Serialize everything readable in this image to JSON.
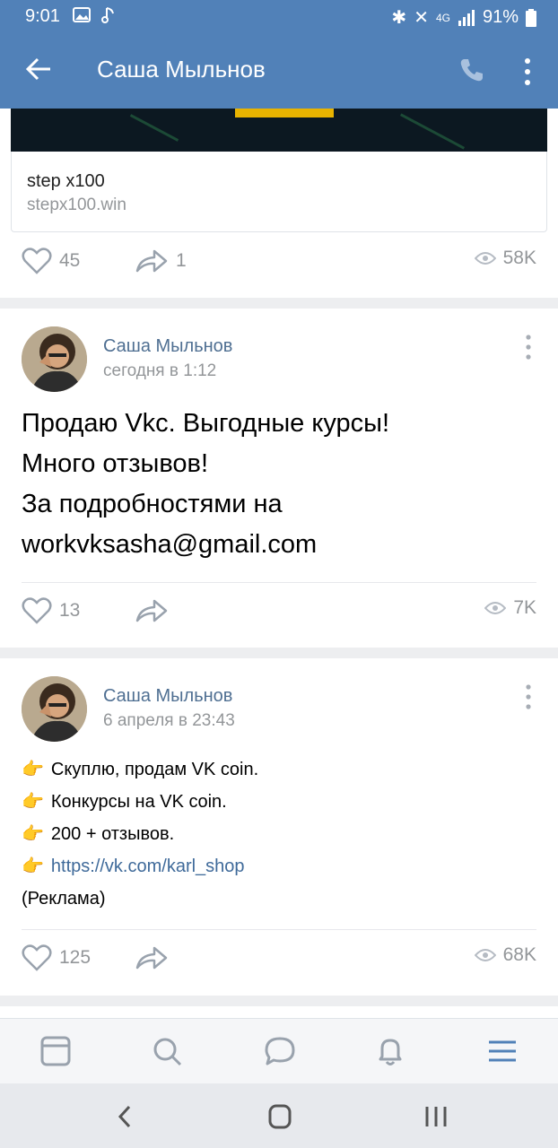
{
  "status_bar": {
    "time": "9:01",
    "battery": "91%",
    "network": "4G"
  },
  "header": {
    "title": "Саша Мыльнов"
  },
  "posts": [
    {
      "link_title": "step x100",
      "link_url": "stepx100.win",
      "likes": "45",
      "shares": "1",
      "views": "58K"
    },
    {
      "author": "Саша Мыльнов",
      "date": "сегодня в 1:12",
      "text": "Продаю Vkc. Выгодные курсы!\nМного отзывов!\nЗа подробностями на\nworkvksasha@gmail.com",
      "likes": "13",
      "views": "7K"
    },
    {
      "author": "Саша Мыльнов",
      "date": "6 апреля в 23:43",
      "lines": [
        "Скуплю, продам VK coin.",
        "Конкурсы на VK coin.",
        "200 + отзывов.",
        "https://vk.com/karl_shop",
        "(Реклама)"
      ],
      "likes": "125",
      "views": "68K"
    }
  ],
  "icons": {
    "pointing": "👉"
  },
  "colors": {
    "header_bg": "#5181b8",
    "link": "#3f6a9a",
    "meta_gray": "#939699"
  }
}
